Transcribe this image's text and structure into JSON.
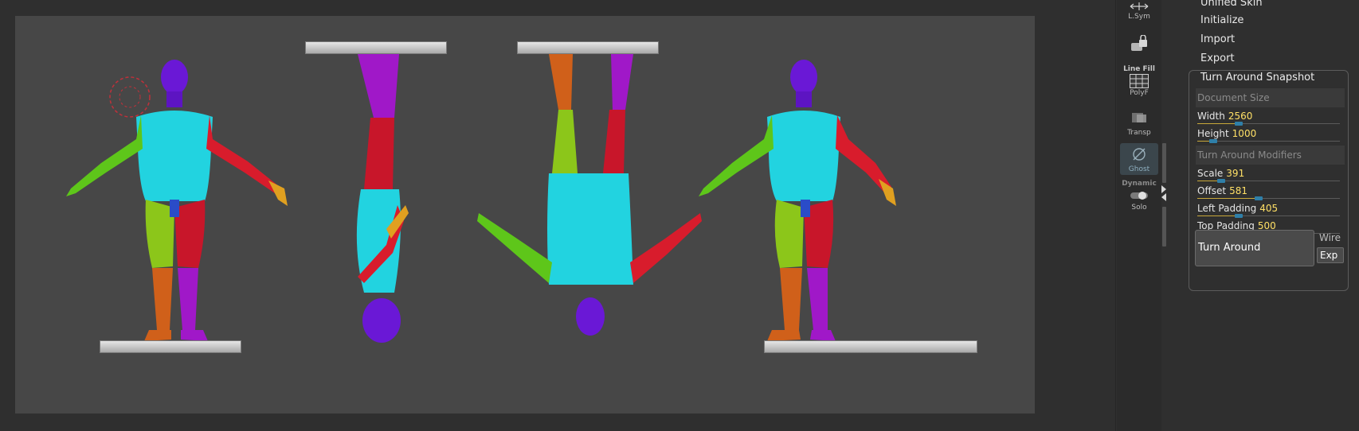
{
  "tool_strip": {
    "lsym_label": "L.Sym",
    "lock_icon": "lock-camera-icon",
    "line_fill_label": "Line Fill",
    "polyf_label": "PolyF",
    "transp_label": "Transp",
    "ghost_label": "Ghost",
    "dynamic_label": "Dynamic",
    "solo_label": "Solo"
  },
  "menu": {
    "items": [
      "Unified Skin",
      "Initialize",
      "Import",
      "Export"
    ]
  },
  "turn_around": {
    "title": "Turn Around Snapshot",
    "document_size_label": "Document Size",
    "width_label": "Width",
    "width_value": "2560",
    "width_fraction": 0.29,
    "height_label": "Height",
    "height_value": "1000",
    "height_fraction": 0.11,
    "modifiers_label": "Turn Around Modifiers",
    "scale_label": "Scale",
    "scale_value": "391",
    "scale_fraction": 0.17,
    "offset_label": "Offset",
    "offset_value": "581",
    "offset_fraction": 0.43,
    "left_padding_label": "Left Padding",
    "left_padding_value": "405",
    "left_padding_fraction": 0.29,
    "top_padding_label": "Top Padding",
    "top_padding_value": "500",
    "top_padding_fraction": 0.23,
    "turn_around_button": "Turn Around",
    "wire_label": "Wire",
    "exp_button": "Exp"
  },
  "colors": {
    "viewport_bg": "#474747",
    "panel_bg": "#2f2f2f",
    "slider_value": "#ffe066",
    "slider_fill": "#c8a83a",
    "slider_knob": "#2f7fa8",
    "head": "#6a18d6",
    "torso": "#22d3e0",
    "left_arm": "#5ec61a",
    "right_arm": "#d81c2c",
    "thigh_left": "#8cc61a",
    "thigh_right": "#c8162a",
    "shin_left": "#d0601a",
    "shin_right": "#a018c8"
  }
}
